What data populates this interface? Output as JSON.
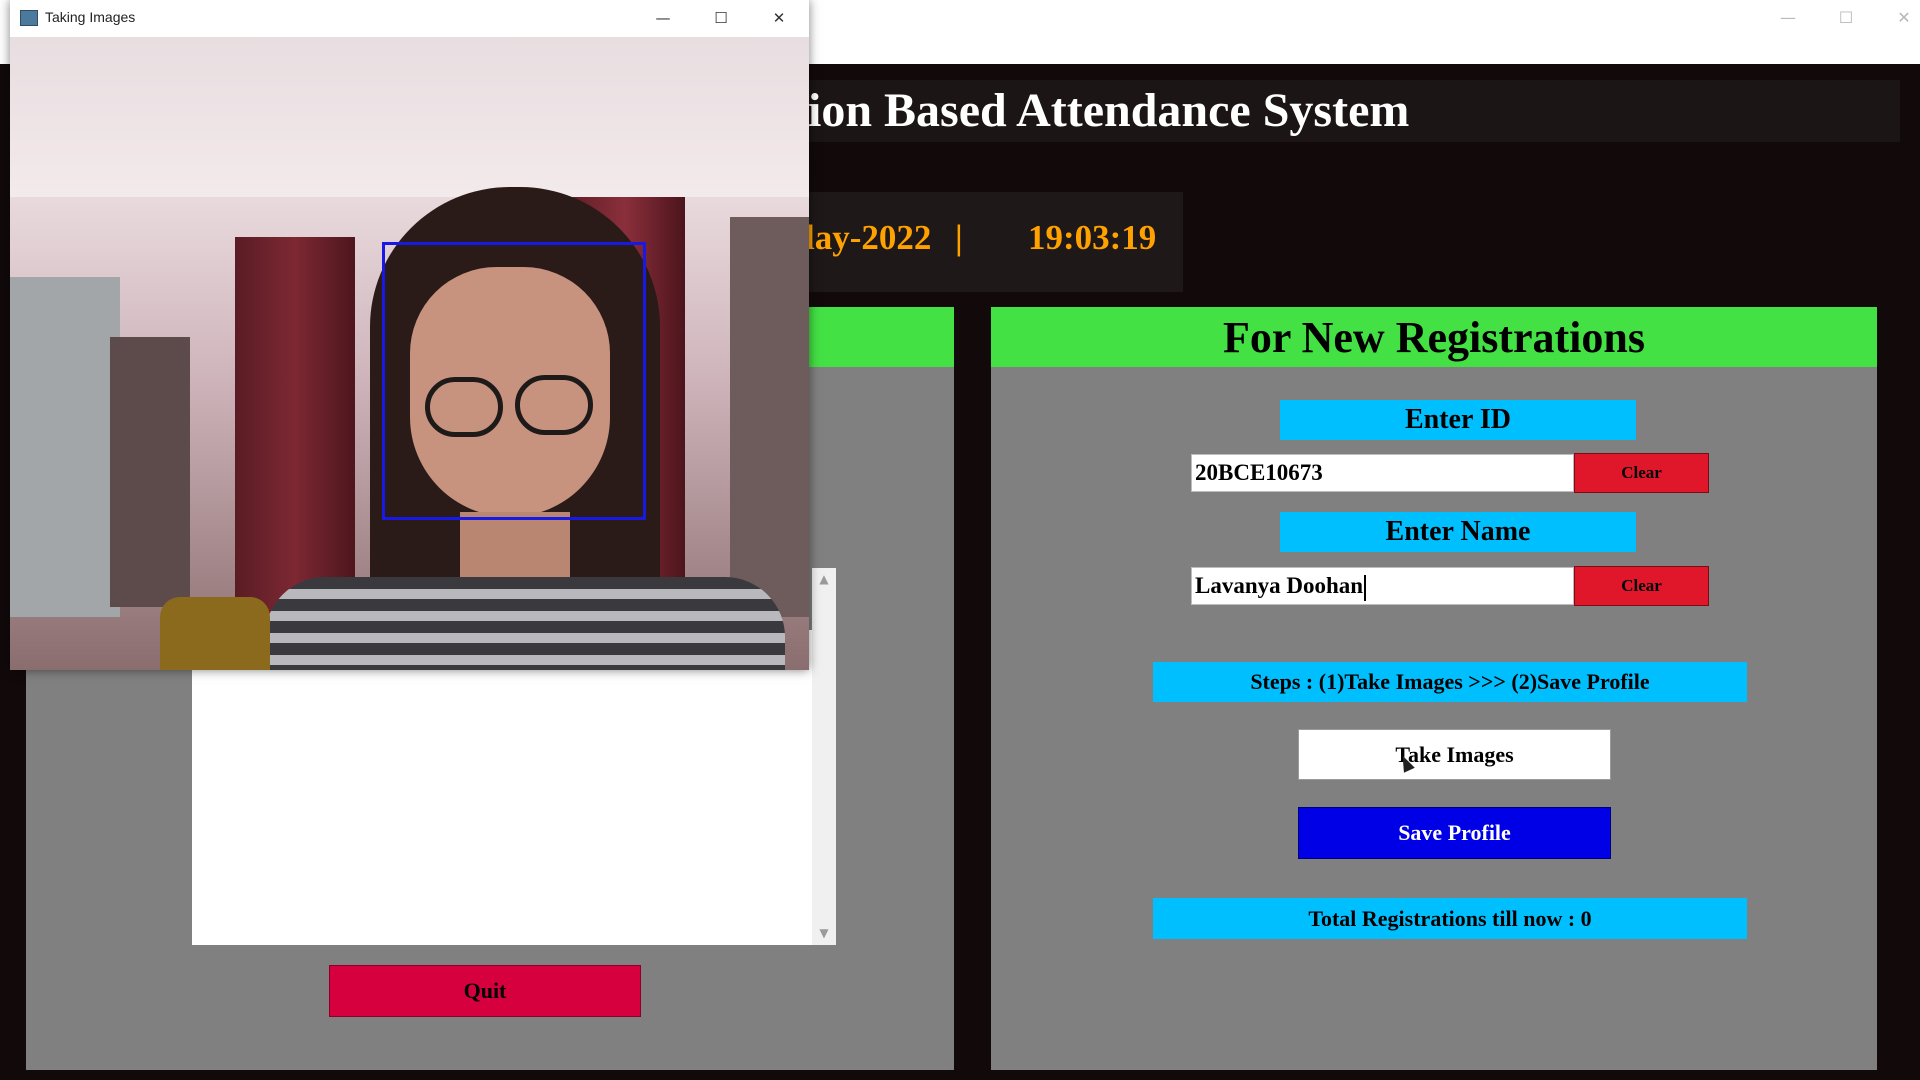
{
  "main_window": {
    "title": "ion Based Attendance System",
    "date": "lay-2022",
    "separator": "|",
    "time": "19:03:19",
    "controls": {
      "minimize": "—",
      "maximize": "☐",
      "close": "✕"
    }
  },
  "left_panel": {
    "quit_label": "Quit"
  },
  "registration": {
    "header": "For New Registrations",
    "id_label": "Enter ID",
    "id_value": "20BCE10673",
    "name_label": "Enter Name",
    "name_value": "Lavanya Doohan",
    "clear_label": "Clear",
    "steps_label": "Steps : (1)Take Images  >>>  (2)Save Profile",
    "take_images_label": "Take Images",
    "save_profile_label": "Save Profile",
    "total_registrations": "Total Registrations till now  : 0"
  },
  "camera_window": {
    "title": "Taking Images",
    "controls": {
      "minimize": "—",
      "maximize": "☐",
      "close": "✕"
    }
  },
  "colors": {
    "panel_header_green": "#44e144",
    "label_cyan": "#00bfff",
    "clear_red": "#e0162b",
    "quit_red": "#d6003f",
    "save_blue": "#0000e6",
    "clock_orange": "#ffa200",
    "face_box_blue": "#1919e6"
  }
}
